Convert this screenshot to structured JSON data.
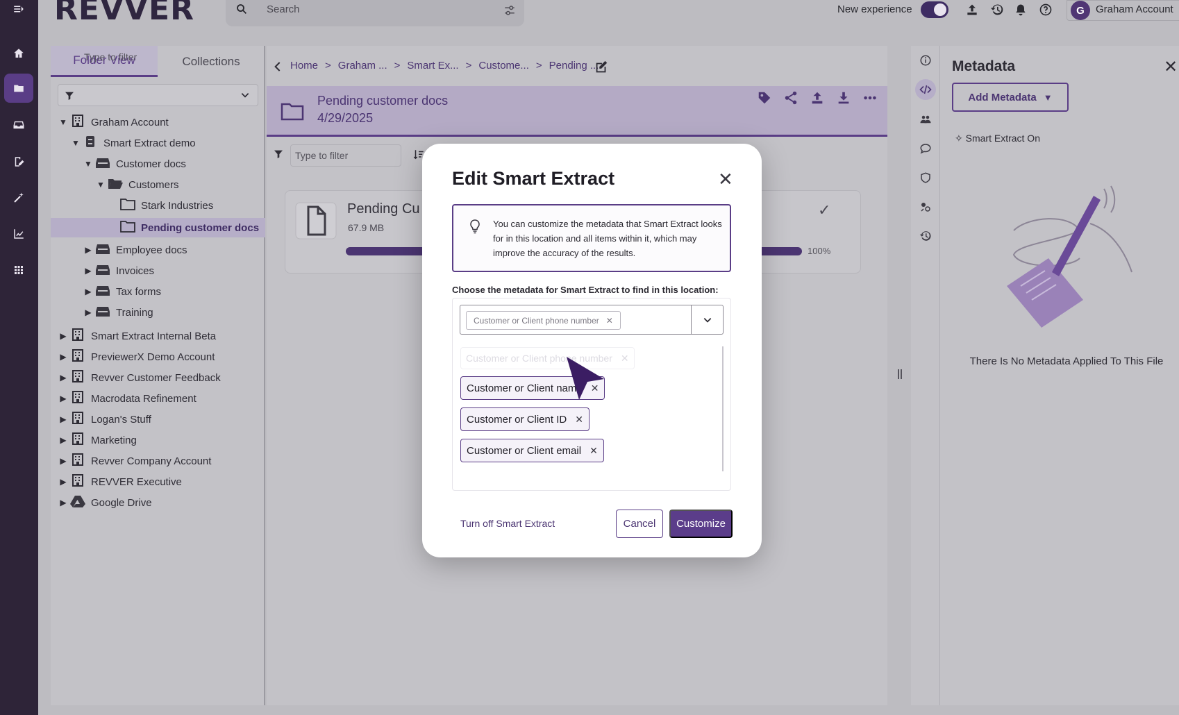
{
  "topbar": {
    "logo": "REVVER",
    "search_placeholder": "Search",
    "new_experience_label": "New experience",
    "account_initial": "G",
    "account_name": "Graham Account"
  },
  "left_panel": {
    "tabs": [
      {
        "label": "Folder View",
        "active": true
      },
      {
        "label": "Collections",
        "active": false
      }
    ],
    "filter_placeholder": "Type to filter",
    "tree": [
      {
        "label": "Graham Account",
        "level": 0,
        "icon": "building-icon",
        "expanded": true
      },
      {
        "label": "Smart Extract demo",
        "level": 1,
        "icon": "cabinet-icon",
        "expanded": true
      },
      {
        "label": "Customer docs",
        "level": 2,
        "icon": "drawer-icon",
        "expanded": true
      },
      {
        "label": "Customers",
        "level": 3,
        "icon": "folder-open-icon",
        "expanded": true
      },
      {
        "label": "Stark Industries",
        "level": 4,
        "icon": "folder-icon"
      },
      {
        "label": "Pending customer docs",
        "level": 4,
        "icon": "folder-icon",
        "selected": true
      },
      {
        "label": "Employee docs",
        "level": 2,
        "icon": "drawer-icon"
      },
      {
        "label": "Invoices",
        "level": 2,
        "icon": "drawer-icon"
      },
      {
        "label": "Tax forms",
        "level": 2,
        "icon": "drawer-icon"
      },
      {
        "label": "Training",
        "level": 2,
        "icon": "drawer-icon"
      },
      {
        "label": "Smart Extract Internal Beta",
        "level": 0,
        "icon": "building-icon"
      },
      {
        "label": "PreviewerX Demo Account",
        "level": 0,
        "icon": "building-icon"
      },
      {
        "label": "Revver Customer Feedback",
        "level": 0,
        "icon": "building-icon"
      },
      {
        "label": "Macrodata Refinement",
        "level": 0,
        "icon": "building-icon"
      },
      {
        "label": "Logan's Stuff",
        "level": 0,
        "icon": "building-icon"
      },
      {
        "label": "Marketing",
        "level": 0,
        "icon": "building-icon"
      },
      {
        "label": "Revver Company Account",
        "level": 0,
        "icon": "building-icon"
      },
      {
        "label": "REVVER Executive",
        "level": 0,
        "icon": "building-icon"
      },
      {
        "label": "Google Drive",
        "level": 0,
        "icon": "google-drive-icon"
      }
    ]
  },
  "center": {
    "breadcrumbs": [
      "Home",
      "Graham ...",
      "Smart Ex...",
      "Custome...",
      "Pending ..."
    ],
    "folder_title": "Pending customer docs",
    "folder_date": "4/29/2025",
    "filter_placeholder": "Type to filter",
    "upload": {
      "title": "Pending Cu",
      "size": "67.9 MB",
      "percent_label": "100%",
      "progress_fraction": 1.0
    }
  },
  "metadata_panel": {
    "title": "Metadata",
    "add_button": "Add Metadata",
    "smart_extract_status": "Smart Extract On",
    "empty_message": "There Is No Metadata Applied To This File"
  },
  "modal": {
    "title": "Edit Smart Extract",
    "info_text": "You can customize the metadata that Smart Extract looks for in this location and all items within it, which may improve the accuracy of the results.",
    "choose_label": "Choose the metadata for Smart Extract to find in this location:",
    "selected_chip": "Customer or Client phone number",
    "dragging_chip": "Customer or Client phone number",
    "options": [
      "Customer or Client name",
      "Customer or Client ID",
      "Customer or Client email"
    ],
    "turn_off_label": "Turn off Smart Extract",
    "cancel_label": "Cancel",
    "customize_label": "Customize"
  },
  "colors": {
    "brand_purple": "#5a3d86",
    "rail_dark": "#2e2438",
    "overlay_gray": "#bdbcc1"
  }
}
